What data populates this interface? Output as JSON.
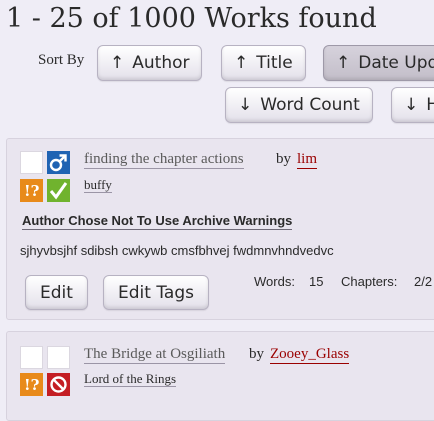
{
  "page": {
    "heading": "1 - 25 of 1000 Works found"
  },
  "sort": {
    "label": "Sort By",
    "buttons": [
      {
        "arrow": "↑",
        "label": "Author"
      },
      {
        "arrow": "↑",
        "label": "Title"
      },
      {
        "arrow": "↑",
        "label": "Date Upd"
      },
      {
        "arrow": "↓",
        "label": "Word Count"
      },
      {
        "arrow": "↓",
        "label": "H"
      }
    ]
  },
  "works": [
    {
      "title": "finding the chapter actions",
      "by": "by",
      "author": "lim",
      "fandom": "buffy",
      "icons": [
        "blank-square",
        "male-symbol-icon",
        "warning-icon",
        "complete-checkmark-icon"
      ],
      "warning": "Author Chose Not To Use Archive Warnings",
      "summary": "sjhyvbsjhf sdibsh cwkywb cmsfbhvej fwdmnvhndvedvc",
      "stats": {
        "words_label": "Words:",
        "words": "15",
        "chapters_label": "Chapters:",
        "chapters": "2/2"
      },
      "actions": [
        "Edit",
        "Edit Tags"
      ]
    },
    {
      "title": "The Bridge at Osgiliath",
      "by": "by",
      "author": "Zooey_Glass",
      "fandom": "Lord of the Rings",
      "icons": [
        "blank-square",
        "blank-square",
        "warning-icon",
        "not-complete-icon"
      ]
    }
  ],
  "colors": {
    "background": "#efedf6",
    "author_link": "#9a0000",
    "warning_orange": "#e88a1a",
    "rating_blue": "#1f63b3",
    "complete_green": "#70b32e",
    "incomplete_red": "#c41e24"
  }
}
